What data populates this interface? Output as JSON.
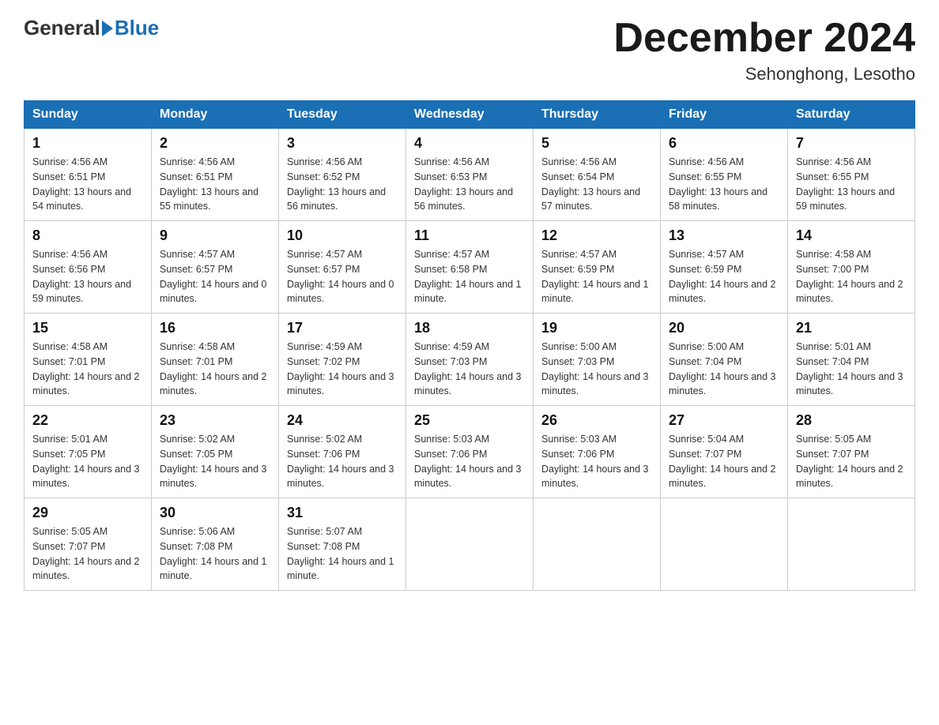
{
  "header": {
    "logo_general": "General",
    "logo_blue": "Blue",
    "month_title": "December 2024",
    "location": "Sehonghong, Lesotho"
  },
  "days_of_week": [
    "Sunday",
    "Monday",
    "Tuesday",
    "Wednesday",
    "Thursday",
    "Friday",
    "Saturday"
  ],
  "weeks": [
    [
      {
        "day": "1",
        "sunrise": "4:56 AM",
        "sunset": "6:51 PM",
        "daylight": "13 hours and 54 minutes."
      },
      {
        "day": "2",
        "sunrise": "4:56 AM",
        "sunset": "6:51 PM",
        "daylight": "13 hours and 55 minutes."
      },
      {
        "day": "3",
        "sunrise": "4:56 AM",
        "sunset": "6:52 PM",
        "daylight": "13 hours and 56 minutes."
      },
      {
        "day": "4",
        "sunrise": "4:56 AM",
        "sunset": "6:53 PM",
        "daylight": "13 hours and 56 minutes."
      },
      {
        "day": "5",
        "sunrise": "4:56 AM",
        "sunset": "6:54 PM",
        "daylight": "13 hours and 57 minutes."
      },
      {
        "day": "6",
        "sunrise": "4:56 AM",
        "sunset": "6:55 PM",
        "daylight": "13 hours and 58 minutes."
      },
      {
        "day": "7",
        "sunrise": "4:56 AM",
        "sunset": "6:55 PM",
        "daylight": "13 hours and 59 minutes."
      }
    ],
    [
      {
        "day": "8",
        "sunrise": "4:56 AM",
        "sunset": "6:56 PM",
        "daylight": "13 hours and 59 minutes."
      },
      {
        "day": "9",
        "sunrise": "4:57 AM",
        "sunset": "6:57 PM",
        "daylight": "14 hours and 0 minutes."
      },
      {
        "day": "10",
        "sunrise": "4:57 AM",
        "sunset": "6:57 PM",
        "daylight": "14 hours and 0 minutes."
      },
      {
        "day": "11",
        "sunrise": "4:57 AM",
        "sunset": "6:58 PM",
        "daylight": "14 hours and 1 minute."
      },
      {
        "day": "12",
        "sunrise": "4:57 AM",
        "sunset": "6:59 PM",
        "daylight": "14 hours and 1 minute."
      },
      {
        "day": "13",
        "sunrise": "4:57 AM",
        "sunset": "6:59 PM",
        "daylight": "14 hours and 2 minutes."
      },
      {
        "day": "14",
        "sunrise": "4:58 AM",
        "sunset": "7:00 PM",
        "daylight": "14 hours and 2 minutes."
      }
    ],
    [
      {
        "day": "15",
        "sunrise": "4:58 AM",
        "sunset": "7:01 PM",
        "daylight": "14 hours and 2 minutes."
      },
      {
        "day": "16",
        "sunrise": "4:58 AM",
        "sunset": "7:01 PM",
        "daylight": "14 hours and 2 minutes."
      },
      {
        "day": "17",
        "sunrise": "4:59 AM",
        "sunset": "7:02 PM",
        "daylight": "14 hours and 3 minutes."
      },
      {
        "day": "18",
        "sunrise": "4:59 AM",
        "sunset": "7:03 PM",
        "daylight": "14 hours and 3 minutes."
      },
      {
        "day": "19",
        "sunrise": "5:00 AM",
        "sunset": "7:03 PM",
        "daylight": "14 hours and 3 minutes."
      },
      {
        "day": "20",
        "sunrise": "5:00 AM",
        "sunset": "7:04 PM",
        "daylight": "14 hours and 3 minutes."
      },
      {
        "day": "21",
        "sunrise": "5:01 AM",
        "sunset": "7:04 PM",
        "daylight": "14 hours and 3 minutes."
      }
    ],
    [
      {
        "day": "22",
        "sunrise": "5:01 AM",
        "sunset": "7:05 PM",
        "daylight": "14 hours and 3 minutes."
      },
      {
        "day": "23",
        "sunrise": "5:02 AM",
        "sunset": "7:05 PM",
        "daylight": "14 hours and 3 minutes."
      },
      {
        "day": "24",
        "sunrise": "5:02 AM",
        "sunset": "7:06 PM",
        "daylight": "14 hours and 3 minutes."
      },
      {
        "day": "25",
        "sunrise": "5:03 AM",
        "sunset": "7:06 PM",
        "daylight": "14 hours and 3 minutes."
      },
      {
        "day": "26",
        "sunrise": "5:03 AM",
        "sunset": "7:06 PM",
        "daylight": "14 hours and 3 minutes."
      },
      {
        "day": "27",
        "sunrise": "5:04 AM",
        "sunset": "7:07 PM",
        "daylight": "14 hours and 2 minutes."
      },
      {
        "day": "28",
        "sunrise": "5:05 AM",
        "sunset": "7:07 PM",
        "daylight": "14 hours and 2 minutes."
      }
    ],
    [
      {
        "day": "29",
        "sunrise": "5:05 AM",
        "sunset": "7:07 PM",
        "daylight": "14 hours and 2 minutes."
      },
      {
        "day": "30",
        "sunrise": "5:06 AM",
        "sunset": "7:08 PM",
        "daylight": "14 hours and 1 minute."
      },
      {
        "day": "31",
        "sunrise": "5:07 AM",
        "sunset": "7:08 PM",
        "daylight": "14 hours and 1 minute."
      },
      null,
      null,
      null,
      null
    ]
  ]
}
